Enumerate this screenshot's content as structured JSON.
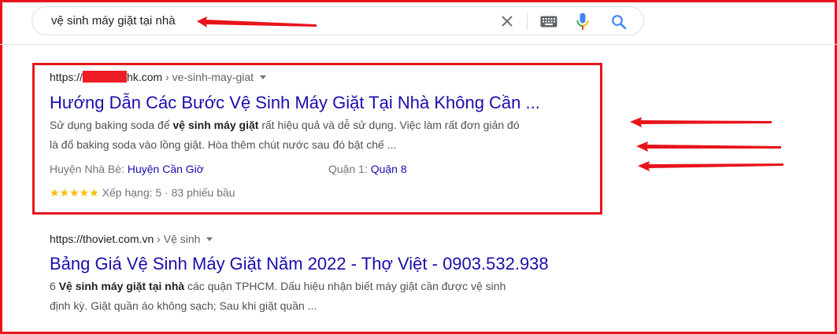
{
  "search": {
    "query": "vệ sinh máy giặt tại nhà",
    "icons": [
      "close-icon",
      "keyboard-icon",
      "microphone-icon",
      "search-icon"
    ],
    "colors": {
      "mic_blue": "#4285f4",
      "mic_red": "#ea4335",
      "mic_yellow": "#fbbc04",
      "mic_green": "#34a853",
      "search_blue": "#4285f4"
    }
  },
  "results": [
    {
      "url_prefix": "https://",
      "url_domain": "hk.com",
      "url_path": " › ve-sinh-may-giat",
      "title": "Hướng Dẫn Các Bước Vệ Sinh Máy Giặt Tại Nhà Không Cần ...",
      "snippet_line1_pre": "Sử dụng baking soda để ",
      "snippet_line1_bold": "vệ sinh máy giặt",
      "snippet_line1_post": " rất hiệu quả và dễ sử dụng. Việc làm rất đơn giản đó",
      "snippet_line2": "là đổ baking soda vào lồng giặt. Hòa thêm chút nước sau đó bật chế ...",
      "sitelink1_label": "Huyện Nhà Bè: ",
      "sitelink1_link": "Huyện Cần Giờ",
      "sitelink2_label": "Quận 1: ",
      "sitelink2_link": "Quận 8",
      "stars": "★★★★★",
      "rating": "Xếp hạng: 5 · 83 phiếu bầu"
    },
    {
      "url_prefix": "https://thoviet.com.vn",
      "url_path": " › Vệ sinh",
      "title": "Bảng Giá Vệ Sinh Máy Giặt Năm 2022 - Thợ Việt - 0903.532.938",
      "snippet_line1_pre": "6 ",
      "snippet_line1_bold": "Vệ sinh máy giặt tại nhà",
      "snippet_line1_post": " các quận TPHCM. Dấu hiệu nhận biết máy giặt cần được vệ sinh",
      "snippet_line2": "định kỳ. Giặt quần áo không sạch; Sau khi giặt quần ..."
    }
  ],
  "annotations": {
    "color": "#e8141c"
  },
  "colors": {
    "link": "#1a0dab",
    "snippet": "#4d5156",
    "star": "#fbbc04"
  }
}
